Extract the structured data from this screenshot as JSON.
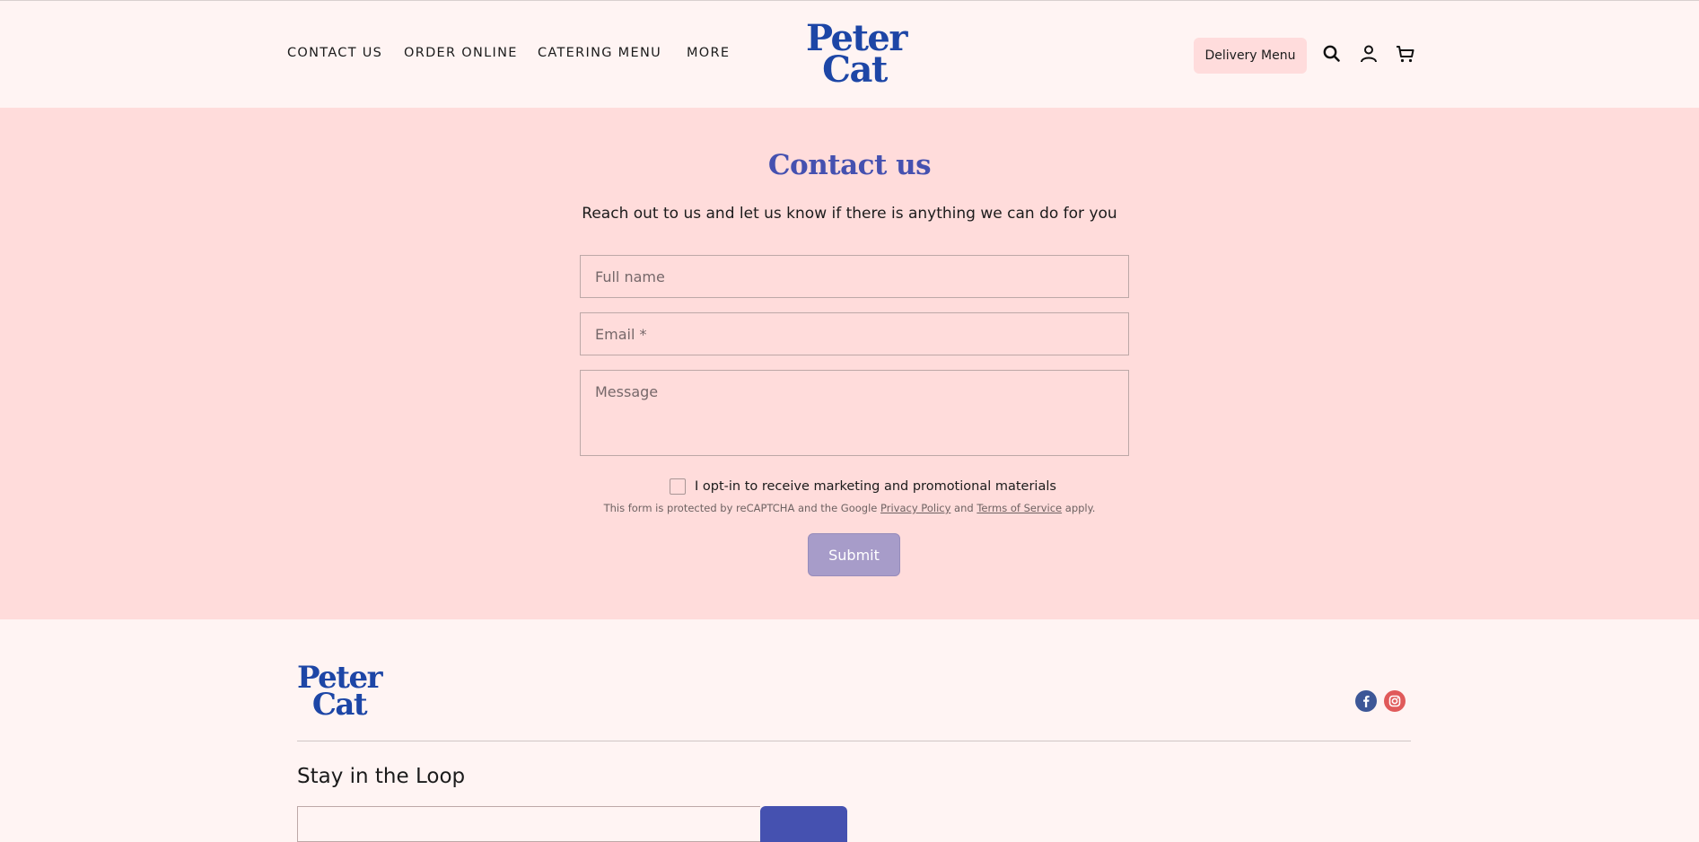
{
  "header": {
    "nav": [
      "CONTACT US",
      "ORDER ONLINE",
      "CATERING MENU",
      "MORE"
    ],
    "logo_line1": "Peter",
    "logo_line2": "Cat",
    "delivery_label": "Delivery Menu",
    "icons": [
      "search-icon",
      "account-icon",
      "cart-icon"
    ]
  },
  "contact": {
    "title": "Contact us",
    "subtitle": "Reach out to us and let us know if there is anything we can do for you",
    "fields": {
      "name_placeholder": "Full name",
      "email_placeholder": "Email *",
      "message_placeholder": "Message"
    },
    "optin_label": "I opt-in to receive marketing and promotional materials",
    "recaptcha": {
      "prefix": "This form is protected by reCAPTCHA and the Google",
      "privacy": "Privacy Policy",
      "and": "and",
      "terms": "Terms of Service",
      "suffix": "apply."
    },
    "submit_label": "Submit"
  },
  "footer": {
    "logo_line1": "Peter",
    "logo_line2": "Cat",
    "social_icons": [
      "facebook-icon",
      "instagram-icon"
    ],
    "newsletter_title": "Stay in the Loop"
  },
  "colors": {
    "brand_blue": "#1d46a6",
    "title_purple": "#4551b0",
    "section_pink": "#ffdcdb",
    "page_bg": "#fff4f3",
    "submit_bg": "#a79cc9"
  }
}
